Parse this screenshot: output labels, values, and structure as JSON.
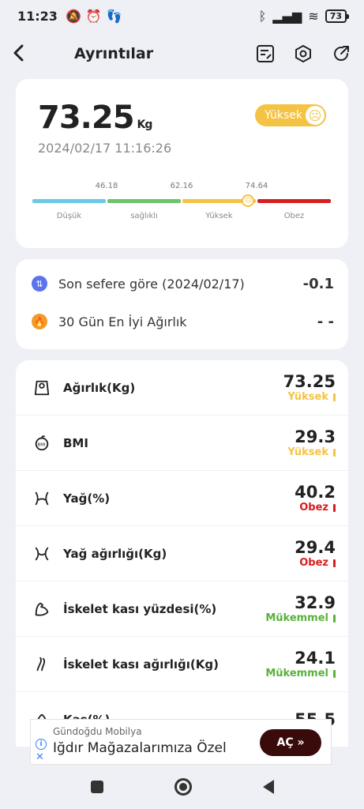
{
  "status": {
    "time": "11:23",
    "battery": "73"
  },
  "header": {
    "title": "Ayrıntılar"
  },
  "summary": {
    "weight": "73.25",
    "unit": "Kg",
    "timestamp": "2024/02/17 11:16:26",
    "badge": "Yüksek",
    "badge_color": "#f5c343",
    "scale": {
      "thresholds": [
        "46.18",
        "62.16",
        "74.64"
      ],
      "segments": [
        "Düşük",
        "sağlıklı",
        "Yüksek",
        "Obez"
      ],
      "segment_colors": [
        "#69c9e6",
        "#6cc36a",
        "#f5c343",
        "#d81e1e"
      ],
      "pointer_value": 73.25
    }
  },
  "comparison": [
    {
      "icon": "compare-icon",
      "label": "Son sefere göre (2024/02/17)",
      "value": "-0.1",
      "color": "#5b73ee"
    },
    {
      "icon": "fire-icon",
      "label": "30 Gün En İyi Ağırlık",
      "value": "- -",
      "color": "#f39a2a"
    }
  ],
  "metrics": [
    {
      "icon": "scale-icon",
      "label": "Ağırlık(Kg)",
      "value": "73.25",
      "status": "Yüksek",
      "color": "#f5c343"
    },
    {
      "icon": "bmi-icon",
      "label": "BMI",
      "value": "29.3",
      "status": "Yüksek",
      "color": "#f5c343"
    },
    {
      "icon": "body-fat-icon",
      "label": "Yağ(%)",
      "value": "40.2",
      "status": "Obez",
      "color": "#d81e1e"
    },
    {
      "icon": "fat-weight-icon",
      "label": "Yağ ağırlığı(Kg)",
      "value": "29.4",
      "status": "Obez",
      "color": "#d81e1e"
    },
    {
      "icon": "muscle-arm-icon",
      "label": "İskelet kası yüzdesi(%)",
      "value": "32.9",
      "status": "Mükemmel",
      "color": "#59b23a"
    },
    {
      "icon": "muscle-leg-icon",
      "label": "İskelet kası ağırlığı(Kg)",
      "value": "24.1",
      "status": "Mükemmel",
      "color": "#59b23a"
    },
    {
      "icon": "muscle-icon",
      "label": "Kas(%)",
      "value": "55.5",
      "status": "",
      "color": "#59b23a"
    }
  ],
  "ad": {
    "advertiser": "Gündoğdu Mobilya",
    "headline": "Iğdır Mağazalarımıza Özel",
    "cta": "AÇ »"
  }
}
